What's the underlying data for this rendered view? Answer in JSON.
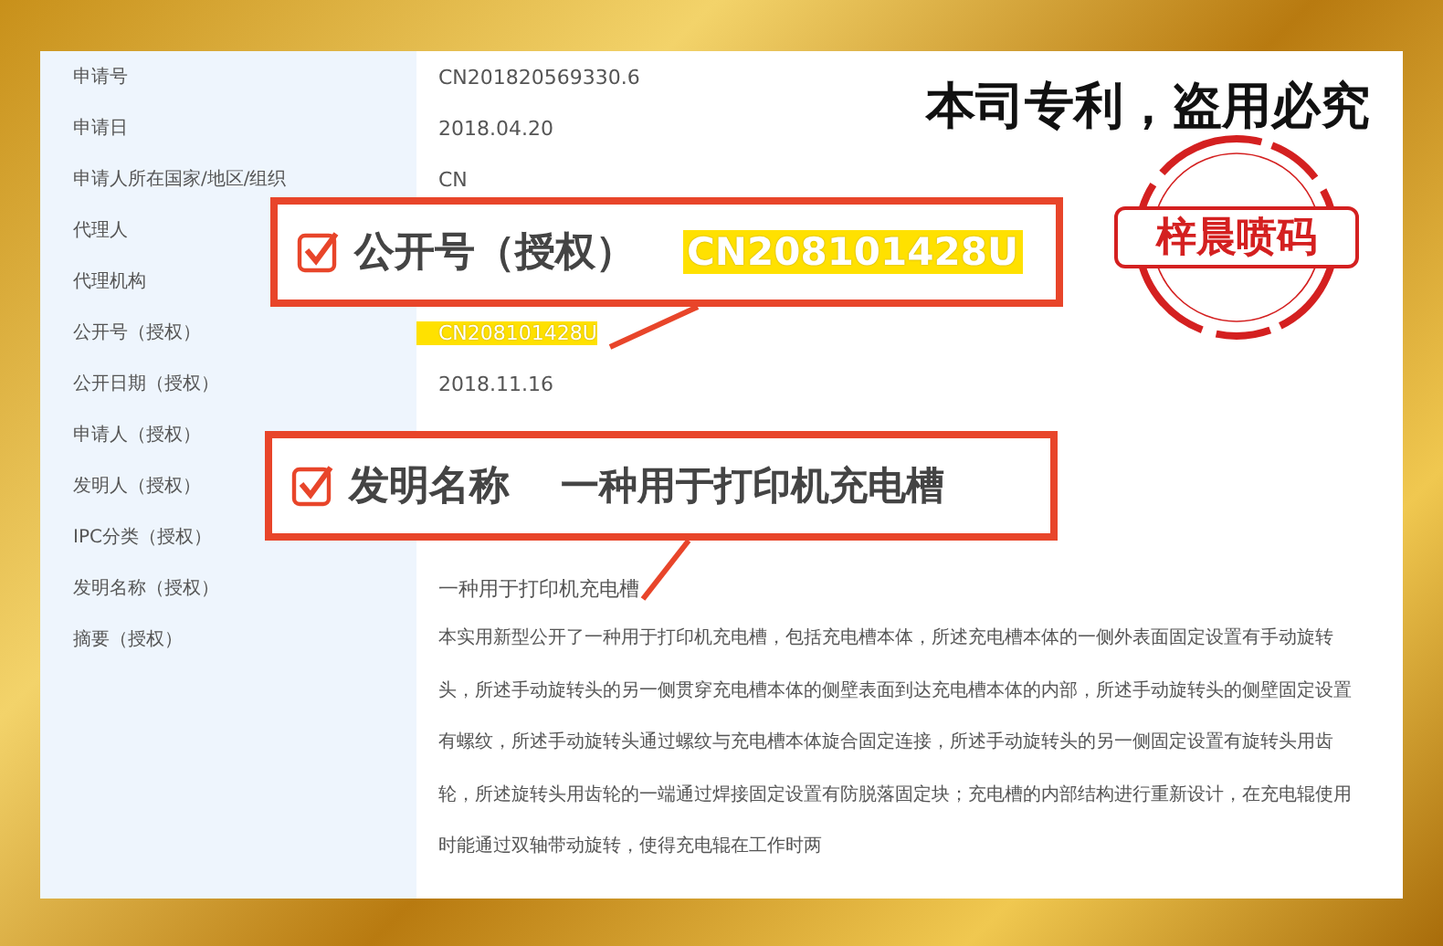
{
  "notice": "本司专利，盗用必究",
  "stamp": {
    "text": "梓晨喷码"
  },
  "rows": [
    {
      "label": "申请号",
      "value": "CN201820569330.6"
    },
    {
      "label": "申请日",
      "value": "2018.04.20"
    },
    {
      "label": "申请人所在国家/地区/组织",
      "value": "CN"
    },
    {
      "label": "代理人"
    },
    {
      "label": "代理机构"
    },
    {
      "label": "公开号（授权）",
      "value": "CN208101428U",
      "highlighted": true
    },
    {
      "label": "公开日期（授权）",
      "value": "2018.11.16"
    },
    {
      "label": "申请人（授权）"
    },
    {
      "label": "发明人（授权）"
    },
    {
      "label": "IPC分类（授权）"
    },
    {
      "label": "发明名称（授权）",
      "value": "一种用于打印机充电槽"
    },
    {
      "label": "摘要（授权）",
      "value": "本实用新型公开了一种用于打印机充电槽，包括充电槽本体，所述充电槽本体的一侧外表面固定设置有手动旋转头，所述手动旋转头的另一侧贯穿充电槽本体的侧壁表面到达充电槽本体的内部，所述手动旋转头的侧壁固定设置有螺纹，所述手动旋转头通过螺纹与充电槽本体旋合固定连接，所述手动旋转头的另一侧固定设置有旋转头用齿轮，所述旋转头用齿轮的一端通过焊接固定设置有防脱落固定块；充电槽的内部结构进行重新设计，在充电辊使用时能通过双轴带动旋转，使得充电辊在工作时两"
    }
  ],
  "callouts": [
    {
      "label": "公开号（授权）",
      "value": "CN208101428U",
      "highlighted": true,
      "checked": true
    },
    {
      "label": "发明名称",
      "value": "一种用于打印机充电槽",
      "highlighted": false,
      "checked": true
    }
  ]
}
